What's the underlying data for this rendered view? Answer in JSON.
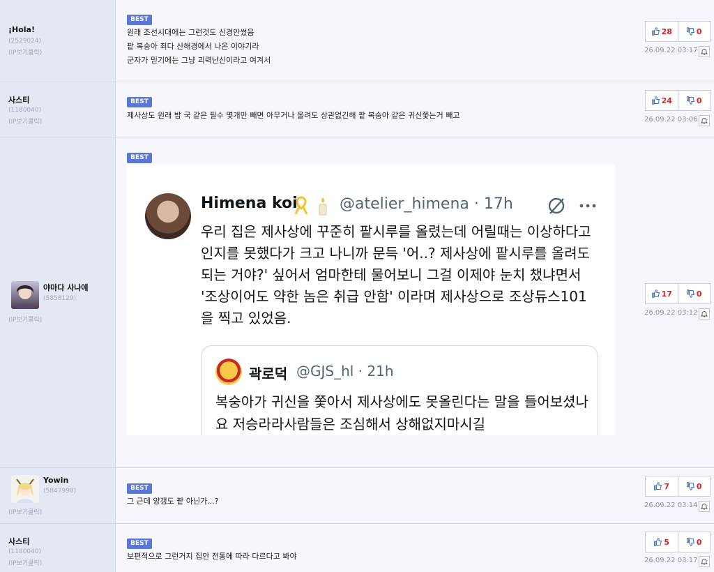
{
  "best_label": "BEST",
  "comments": [
    {
      "nick": "¡Hola!",
      "uid": "(2529024)",
      "ip": "(IP보기클릭)",
      "lines": [
        "원래 조선시대에는 그런것도 신경안썼음",
        "팥 복숭아 죄다 산해경에서 나온 이야기라",
        "군자가 믿기에는 그냥 괴력난신이라고 여겨서"
      ],
      "up": "28",
      "down": "0",
      "date": "26.09.22 03:17"
    },
    {
      "nick": "사스티",
      "uid": "(1180040)",
      "ip": "(IP보기클릭)",
      "lines": [
        "제사상도 원래 밥 국 같은 필수 몇개만 빼면 아무거나 올려도 상관없긴해 팥 복숭아 같은 귀신쫓는거 빼고"
      ],
      "up": "24",
      "down": "0",
      "date": "26.09.22 03:06"
    },
    {
      "nick": "야마다 사나에",
      "uid": "(5858129)",
      "ip": "(IP보기클릭)",
      "up": "17",
      "down": "0",
      "date": "26.09.22 03:12"
    },
    {
      "nick": "Yowin",
      "uid": "(5847998)",
      "ip": "(IP보기클릭)",
      "lines": [
        "그 근데 양갱도 팥 아닌가...?"
      ],
      "up": "7",
      "down": "0",
      "date": "26.09.22 03:14"
    },
    {
      "nick": "사스티",
      "uid": "(1180040)",
      "ip": "(IP보기클릭)",
      "lines": [
        "보편적으로 그런거지 집안 전통에 따라 다르다고 봐야"
      ],
      "up": "5",
      "down": "0",
      "date": "26.09.22 03:17"
    }
  ],
  "tweet": {
    "name": "Himena koi",
    "handle": "@atelier_himena · 17h",
    "body": "우리 집은 제사상에 꾸준히 팥시루를 올렸는데 어릴때는 이상하다고 인지를 못했다가 크고 나니까 문득 '어..? 제사상에 팥시루를 올려도 되는 거야?' 싶어서 엄마한테 물어보니 그걸 이제야 눈치 챘냐면서 '조상이어도 약한 놈은 취급 안함' 이라며 제사상으로 조상듀스101을 찍고 있었음.",
    "quote": {
      "name": "곽로덕",
      "handle": "@GJS_hl · 21h",
      "body": "복숭아가 귀신을 쫓아서 제사상에도 못올린다는 말을 들어보셨나요 저승라라사람들은 조심해서 상해없지마시길"
    }
  }
}
